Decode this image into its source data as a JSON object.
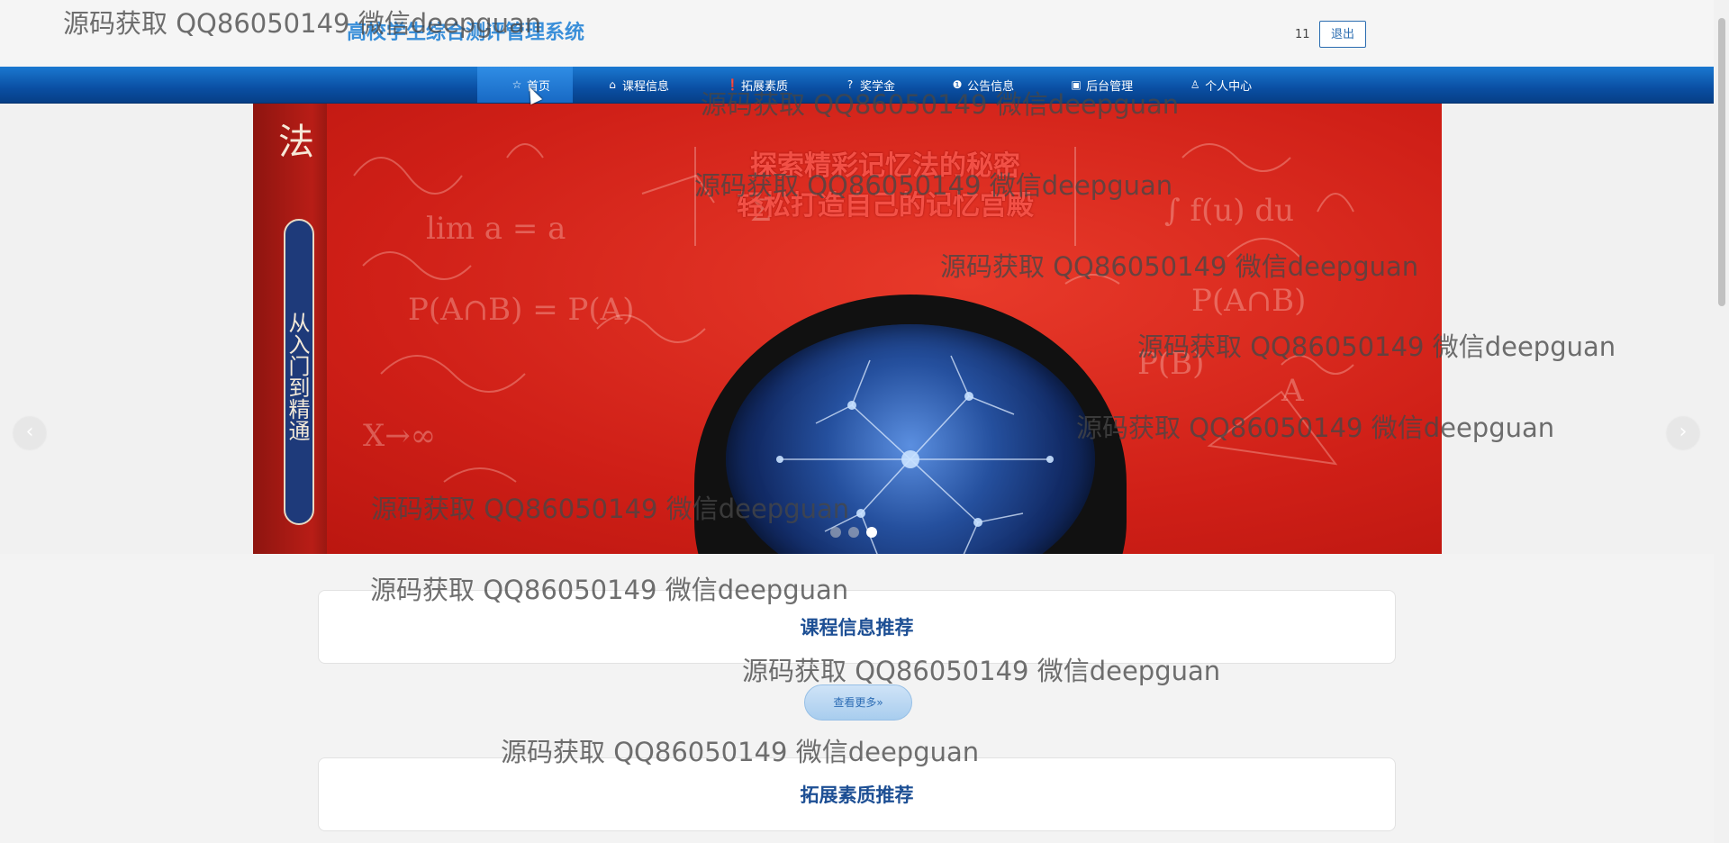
{
  "header": {
    "site_title": "高校学生综合测评管理系统",
    "username": "11",
    "logout_label": "退出"
  },
  "nav": {
    "items": [
      {
        "label": "首页",
        "icon": "star-icon",
        "glyph": "☆"
      },
      {
        "label": "课程信息",
        "icon": "bag-icon",
        "glyph": "⌂"
      },
      {
        "label": "拓展素质",
        "icon": "info-icon",
        "glyph": "❗"
      },
      {
        "label": "奖学金",
        "icon": "question-icon",
        "glyph": "?"
      },
      {
        "label": "公告信息",
        "icon": "info-circle-icon",
        "glyph": "❶"
      },
      {
        "label": "后台管理",
        "icon": "clipboard-icon",
        "glyph": "▣"
      },
      {
        "label": "个人中心",
        "icon": "user-icon",
        "glyph": "♙"
      }
    ],
    "active_index": 0
  },
  "banner": {
    "spine_title": "法",
    "spine_subtitle": "从入门到精通",
    "cover_lines": [
      "探索精彩记忆法的秘密",
      "轻松打造自己的记忆宫殿"
    ],
    "dots_count": 3,
    "active_dot": 2,
    "prev_glyph": "‹",
    "next_glyph": "›"
  },
  "sections": {
    "course_title": "课程信息推荐",
    "more_label": "查看更多»",
    "quality_title": "拓展素质推荐"
  },
  "watermark": {
    "text": "源码获取 QQ86050149 微信deepguan"
  },
  "colors": {
    "nav_bg": "#0a4fa3",
    "title_color": "#3a8fd9",
    "section_title_color": "#1d4f94",
    "banner_red": "#cf1f17"
  }
}
